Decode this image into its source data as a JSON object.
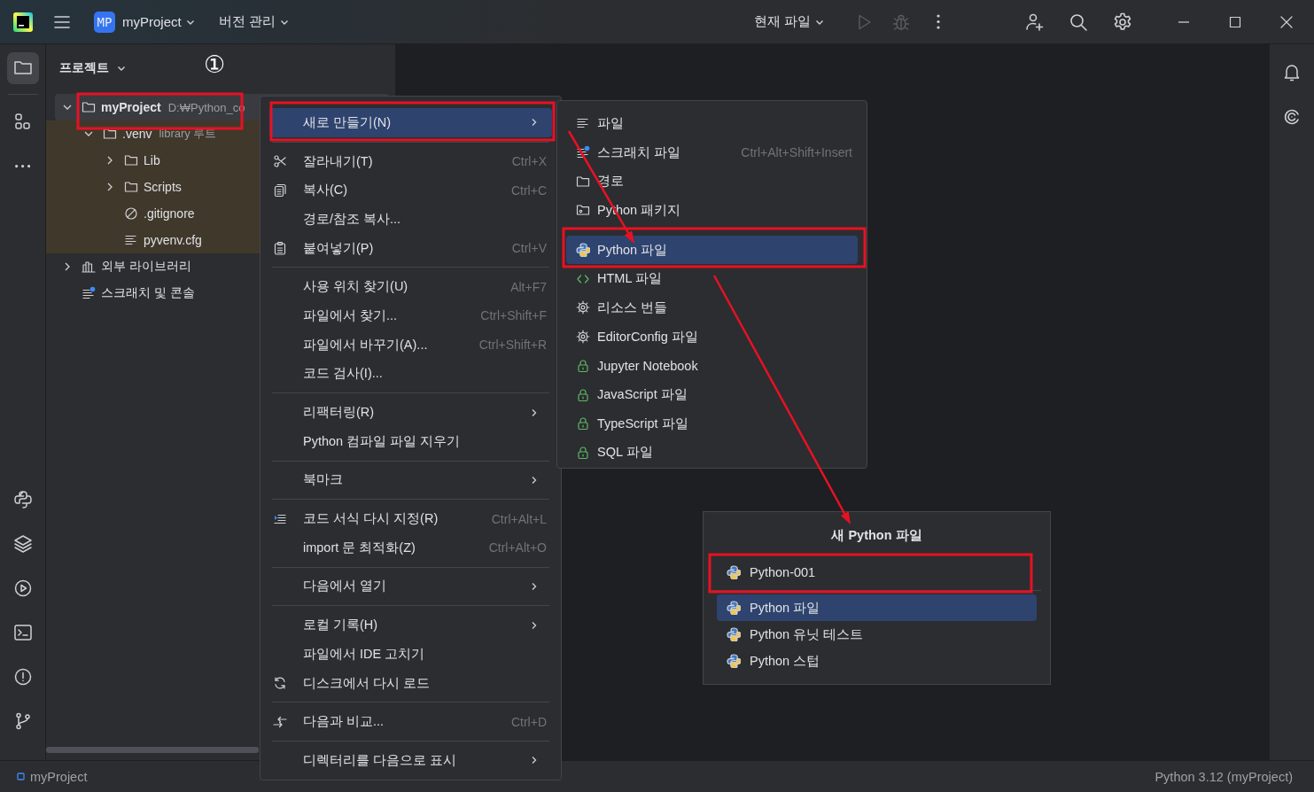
{
  "title_bar": {
    "project_badge": "MP",
    "project": "myProject",
    "vcs": "버전 관리",
    "run_config": "현재 파일",
    "run_disabled": true,
    "debug_disabled": true
  },
  "left_toolbar": {
    "top": [
      {
        "kind": "project",
        "selected": true
      },
      {
        "kind": "structure",
        "selected": false
      },
      {
        "kind": "more",
        "selected": false
      }
    ],
    "bottom": [
      {
        "kind": "python-console",
        "selected": false
      },
      {
        "kind": "layers",
        "selected": false
      },
      {
        "kind": "run",
        "selected": false
      },
      {
        "kind": "terminal",
        "selected": false
      },
      {
        "kind": "problems",
        "selected": false
      },
      {
        "kind": "git",
        "selected": false
      }
    ]
  },
  "project_panel": {
    "title": "프로젝트",
    "step_marker": "①",
    "tree": [
      {
        "kind": "folder",
        "label": "myProject",
        "detail": "D:₩Python_co",
        "expanded": true,
        "selected": true,
        "highlighted": false,
        "children": [
          {
            "kind": "folder",
            "label": ".venv",
            "detail": "library 루트",
            "expanded": true,
            "selected": false,
            "highlighted": true,
            "children": [
              {
                "kind": "folder",
                "label": "Lib",
                "expanded": false,
                "selected": false,
                "highlighted": true
              },
              {
                "kind": "folder",
                "label": "Scripts",
                "expanded": false,
                "selected": false,
                "highlighted": true
              },
              {
                "kind": "ignore",
                "label": ".gitignore",
                "selected": false,
                "highlighted": true
              },
              {
                "kind": "config",
                "label": "pyvenv.cfg",
                "selected": false,
                "highlighted": true
              }
            ]
          }
        ]
      },
      {
        "kind": "library",
        "label": "외부 라이브러리",
        "expanded": false,
        "selected": false,
        "highlighted": false
      },
      {
        "kind": "scratch",
        "label": "스크래치 및 콘솔",
        "selected": false,
        "highlighted": false
      }
    ]
  },
  "context_menu": {
    "groups": [
      {
        "items": [
          {
            "kind": "plain",
            "label": "새로 만들기(N)",
            "submenu": true,
            "selected": true
          }
        ]
      },
      {
        "items": [
          {
            "kind": "cut",
            "label": "잘라내기(T)",
            "shortcut": "Ctrl+X",
            "submenu": false,
            "selected": false
          },
          {
            "kind": "copy",
            "label": "복사(C)",
            "shortcut": "Ctrl+C",
            "submenu": false,
            "selected": false
          },
          {
            "kind": "plain",
            "label": "경로/참조 복사...",
            "submenu": false,
            "selected": false
          },
          {
            "kind": "paste",
            "label": "붙여넣기(P)",
            "shortcut": "Ctrl+V",
            "submenu": false,
            "selected": false
          }
        ]
      },
      {
        "items": [
          {
            "kind": "plain",
            "label": "사용 위치 찾기(U)",
            "shortcut": "Alt+F7",
            "submenu": false,
            "selected": false
          },
          {
            "kind": "plain",
            "label": "파일에서 찾기...",
            "shortcut": "Ctrl+Shift+F",
            "submenu": false,
            "selected": false
          },
          {
            "kind": "plain",
            "label": "파일에서 바꾸기(A)...",
            "shortcut": "Ctrl+Shift+R",
            "submenu": false,
            "selected": false
          },
          {
            "kind": "plain",
            "label": "코드 검사(I)...",
            "submenu": false,
            "selected": false
          }
        ]
      },
      {
        "items": [
          {
            "kind": "plain",
            "label": "리팩터링(R)",
            "submenu": true,
            "selected": false
          },
          {
            "kind": "plain",
            "label": "Python 컴파일 파일 지우기",
            "submenu": false,
            "selected": false
          }
        ]
      },
      {
        "items": [
          {
            "kind": "plain",
            "label": "북마크",
            "submenu": true,
            "selected": false
          }
        ]
      },
      {
        "items": [
          {
            "kind": "reformat",
            "label": "코드 서식 다시 지정(R)",
            "shortcut": "Ctrl+Alt+L",
            "submenu": false,
            "selected": false
          },
          {
            "kind": "plain",
            "label": "import 문 최적화(Z)",
            "shortcut": "Ctrl+Alt+O",
            "submenu": false,
            "selected": false
          }
        ]
      },
      {
        "items": [
          {
            "kind": "plain",
            "label": "다음에서 열기",
            "submenu": true,
            "selected": false
          }
        ]
      },
      {
        "items": [
          {
            "kind": "plain",
            "label": "로컬 기록(H)",
            "submenu": true,
            "selected": false
          },
          {
            "kind": "plain",
            "label": "파일에서 IDE 고치기",
            "submenu": false,
            "selected": false
          },
          {
            "kind": "reload",
            "label": "디스크에서 다시 로드",
            "submenu": false,
            "selected": false
          }
        ]
      },
      {
        "items": [
          {
            "kind": "compare",
            "label": "다음과 비교...",
            "shortcut": "Ctrl+D",
            "submenu": false,
            "selected": false
          }
        ]
      },
      {
        "items": [
          {
            "kind": "plain",
            "label": "디렉터리를 다음으로 표시",
            "submenu": true,
            "selected": false
          }
        ]
      }
    ]
  },
  "new_submenu": {
    "groups": [
      {
        "items": [
          {
            "kind": "text",
            "label": "파일",
            "selected": false
          },
          {
            "kind": "scratch",
            "label": "스크래치 파일",
            "shortcut": "Ctrl+Alt+Shift+Insert",
            "selected": false
          },
          {
            "kind": "directory",
            "label": "경로",
            "selected": false
          },
          {
            "kind": "package",
            "label": "Python 패키지",
            "selected": false
          }
        ]
      },
      {
        "items": [
          {
            "kind": "python",
            "label": "Python 파일",
            "selected": true
          },
          {
            "kind": "html",
            "label": "HTML 파일",
            "selected": false
          },
          {
            "kind": "gear",
            "label": "리소스 번들",
            "selected": false
          },
          {
            "kind": "gear",
            "label": "EditorConfig 파일",
            "selected": false
          },
          {
            "kind": "locked",
            "label": "Jupyter Notebook",
            "selected": false
          },
          {
            "kind": "locked",
            "label": "JavaScript 파일",
            "selected": false
          },
          {
            "kind": "locked",
            "label": "TypeScript 파일",
            "selected": false
          },
          {
            "kind": "locked",
            "label": "SQL 파일",
            "selected": false
          }
        ]
      }
    ]
  },
  "new_file_dialog": {
    "title": "새 Python 파일",
    "value": "Python-001",
    "options": [
      {
        "label": "Python 파일",
        "selected": true
      },
      {
        "label": "Python 유닛 테스트",
        "selected": false
      },
      {
        "label": "Python 스텁",
        "selected": false
      }
    ]
  },
  "status_bar": {
    "project": "myProject",
    "interpreter": "Python 3.12 (myProject)"
  }
}
